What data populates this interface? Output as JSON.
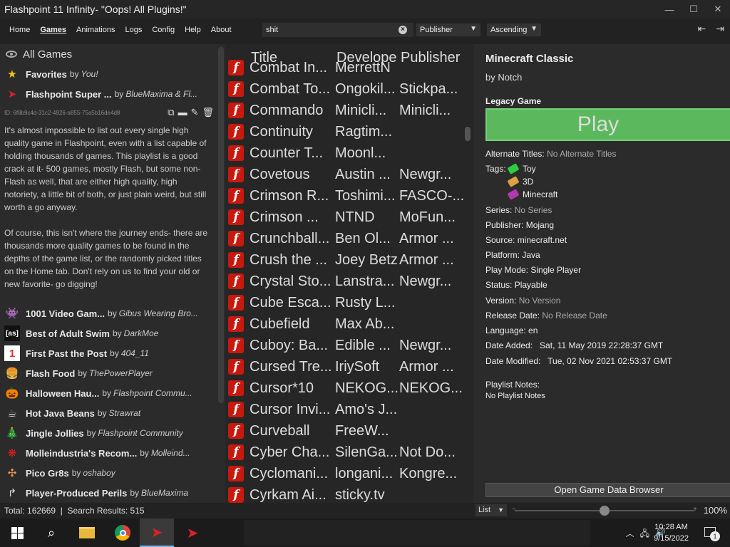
{
  "window": {
    "title": "Flashpoint 11 Infinity- \"Oops! All Plugins!\"",
    "minimize_icon": "—",
    "maximize_icon": "☐",
    "close_icon": "✕"
  },
  "menu": {
    "items": [
      "Home",
      "Games",
      "Animations",
      "Logs",
      "Config",
      "Help",
      "About"
    ],
    "active": "Games",
    "search_value": "shit",
    "order_by": "Publisher",
    "order_dir": "Ascending"
  },
  "sidebar": {
    "all_games_label": "All Games",
    "playlists_top": [
      {
        "name": "Favorites",
        "by": "by",
        "author": "You!",
        "icon": "star-icon",
        "glyph": "★",
        "color": "#f5c518"
      },
      {
        "name": "Flashpoint Super ...",
        "by": "by",
        "author": "BlueMaxima & Fl...",
        "icon": "flashpoint-icon",
        "glyph": "➤",
        "color": "#d6222a"
      }
    ],
    "playlist_id": "ID: 6f8b9c4d-31c2-4926-a855-75a5b16de4d8",
    "description_p1": "It's almost impossible to list out every single high quality game in Flashpoint, even with a list capable of holding thousands of games. This playlist is a good crack at it- 500 games, mostly Flash, but some non-Flash as well, that are either high quality, high notoriety, a little bit of both, or just plain weird, but still worth a go anyway.",
    "description_p2": "Of course, this isn't where the journey ends- there are thousands more quality games to be found in the depths of the game list, or the randomly picked titles on the Home tab. Don't rely on us to find your old or new favorite- go digging!",
    "playlists": [
      {
        "name": "1001 Video Gam...",
        "by": "by",
        "author": "Gibus Wearing Bro...",
        "icon": "invader-icon",
        "glyph": "👾",
        "color": "#eee"
      },
      {
        "name": "Best of Adult Swim",
        "by": "by",
        "author": "DarkMoe",
        "icon": "adult-swim-icon",
        "glyph": "[as]",
        "color": "#fff"
      },
      {
        "name": "First Past the Post",
        "by": "by",
        "author": "404_11",
        "icon": "number-one-icon",
        "glyph": "1",
        "color": "#d33"
      },
      {
        "name": "Flash Food",
        "by": "by",
        "author": "ThePowerPlayer",
        "icon": "burger-icon",
        "glyph": "🍔",
        "color": "#d9a441"
      },
      {
        "name": "Halloween Hau...",
        "by": "by",
        "author": "Flashpoint Commu...",
        "icon": "pumpkin-icon",
        "glyph": "🎃",
        "color": "#e67e22"
      },
      {
        "name": "Hot Java Beans",
        "by": "by",
        "author": "Strawrat",
        "icon": "java-cup-icon",
        "glyph": "☕",
        "color": "#ddd"
      },
      {
        "name": "Jingle Jollies",
        "by": "by",
        "author": "Flashpoint Community",
        "icon": "tree-icon",
        "glyph": "🎄",
        "color": "#2e8b2e"
      },
      {
        "name": "Molleindustria's Recom...",
        "by": "by",
        "author": "Molleind...",
        "icon": "molleindustria-icon",
        "glyph": "❋",
        "color": "#d22"
      },
      {
        "name": "Pico Gr8s",
        "by": "by",
        "author": "oshaboy",
        "icon": "pico-icon",
        "glyph": "✣",
        "color": "#e95"
      },
      {
        "name": "Player-Produced Perils",
        "by": "by",
        "author": "BlueMaxima",
        "icon": "share-arrow-icon",
        "glyph": "↱",
        "color": "#ddd"
      }
    ]
  },
  "game_list": {
    "headers": [
      "Title",
      "Develope",
      "Publisher"
    ],
    "partial_row": [
      "Combat In...",
      "MerrettN",
      ""
    ],
    "rows": [
      [
        "Combat To...",
        "Ongokil...",
        "Stickpa..."
      ],
      [
        "Commando",
        "Minicli...",
        "Minicli..."
      ],
      [
        "Continuity",
        "Ragtim...",
        ""
      ],
      [
        "Counter T...",
        "Moonl...",
        ""
      ],
      [
        "Covetous",
        "Austin ...",
        "Newgr..."
      ],
      [
        "Crimson R...",
        "Toshimi...",
        "FASCO-..."
      ],
      [
        "Crimson ...",
        "NTND",
        "MoFun..."
      ],
      [
        "Crunchball...",
        "Ben Ol...",
        "Armor ..."
      ],
      [
        "Crush the ...",
        "Joey Betz",
        "Armor ..."
      ],
      [
        "Crystal Sto...",
        "Lanstra...",
        "Newgr..."
      ],
      [
        "Cube Esca...",
        "Rusty L...",
        ""
      ],
      [
        "Cubefield",
        "Max Ab...",
        ""
      ],
      [
        "Cuboy: Ba...",
        "Edible ...",
        "Newgr..."
      ],
      [
        "Cursed Tre...",
        "IriySoft",
        "Armor ..."
      ],
      [
        "Cursor*10",
        "NEKOG...",
        "NEKOG..."
      ],
      [
        "Cursor Invi...",
        "Amo's J...",
        ""
      ],
      [
        "Curveball",
        "FreeW...",
        ""
      ],
      [
        "Cyber Cha...",
        "SilenGa...",
        "Not Do..."
      ],
      [
        "Cyclomani...",
        "longani...",
        "Kongre..."
      ],
      [
        "Cyrkam Ai...",
        "sticky.tv",
        ""
      ]
    ],
    "flash_glyph": "f"
  },
  "details": {
    "title": "Minecraft Classic",
    "by": "by Notch",
    "legacy_label": "Legacy Game",
    "play_label": "Play",
    "alt_titles_label": "Alternate Titles:",
    "alt_titles_value": "No Alternate Titles",
    "tags_label": "Tags:",
    "tags": [
      {
        "name": "Toy",
        "color": "#2ecc40"
      },
      {
        "name": "3D",
        "color": "#e0a040"
      },
      {
        "name": "Minecraft",
        "color": "#b03ab0"
      }
    ],
    "series_label": "Series:",
    "series_value": "No Series",
    "publisher": "Publisher: Mojang",
    "source": "Source: minecraft.net",
    "platform": "Platform: Java",
    "play_mode": "Play Mode: Single Player",
    "status": "Status: Playable",
    "version_label": "Version:",
    "version_value": "No Version",
    "release_label": "Release Date:",
    "release_value": "No Release Date",
    "language": "Language: en",
    "date_added": "Date Added:   Sat, 11 May 2019 22:28:37 GMT",
    "date_modified": "Date Modified:   Tue, 02 Nov 2021 02:53:37 GMT",
    "notes_label": "Playlist Notes:",
    "notes_value": "No Playlist Notes",
    "open_data_label": "Open Game Data Browser"
  },
  "status": {
    "totals": "Total: 162669  |  Search Results: 515",
    "view_mode": "List",
    "zoom": "100%",
    "zoom_level_percent": 50
  },
  "taskbar": {
    "time": "10:28 AM",
    "date": "9/15/2022",
    "notification_count": "1"
  }
}
